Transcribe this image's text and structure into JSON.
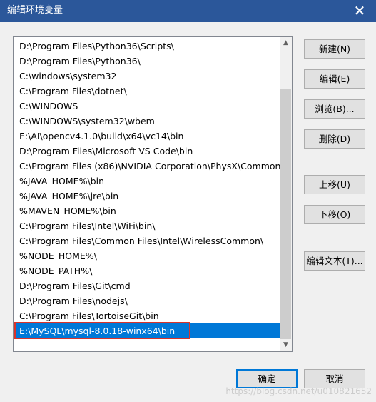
{
  "window": {
    "title": "编辑环境变量",
    "close_glyph": "✕"
  },
  "list": {
    "items": [
      "D:\\Program Files\\Python36\\Scripts\\",
      "D:\\Program Files\\Python36\\",
      "C:\\windows\\system32",
      "C:\\Program Files\\dotnet\\",
      "C:\\WINDOWS",
      "C:\\WINDOWS\\system32\\wbem",
      "E:\\AI\\opencv4.1.0\\build\\x64\\vc14\\bin",
      "D:\\Program Files\\Microsoft VS Code\\bin",
      "C:\\Program Files (x86)\\NVIDIA Corporation\\PhysX\\Common",
      "%JAVA_HOME%\\bin",
      "%JAVA_HOME%\\jre\\bin",
      "%MAVEN_HOME%\\bin",
      "C:\\Program Files\\Intel\\WiFi\\bin\\",
      "C:\\Program Files\\Common Files\\Intel\\WirelessCommon\\",
      "%NODE_HOME%\\",
      "%NODE_PATH%\\",
      "D:\\Program Files\\Git\\cmd",
      "D:\\Program Files\\nodejs\\",
      "C:\\Program Files\\TortoiseGit\\bin",
      "E:\\MySQL\\mysql-8.0.18-winx64\\bin"
    ],
    "selected_index": 19,
    "scroll_up": "▲",
    "scroll_down": "▼"
  },
  "buttons": {
    "new": "新建(N)",
    "edit": "编辑(E)",
    "browse": "浏览(B)...",
    "delete": "删除(D)",
    "move_up": "上移(U)",
    "move_down": "下移(O)",
    "edit_text": "编辑文本(T)...",
    "ok": "确定",
    "cancel": "取消"
  },
  "watermark": "https://blog.csdn.net/u010821652",
  "colors": {
    "titlebar": "#2b579a",
    "selection": "#0078d7",
    "highlight_box": "#d9342b"
  }
}
